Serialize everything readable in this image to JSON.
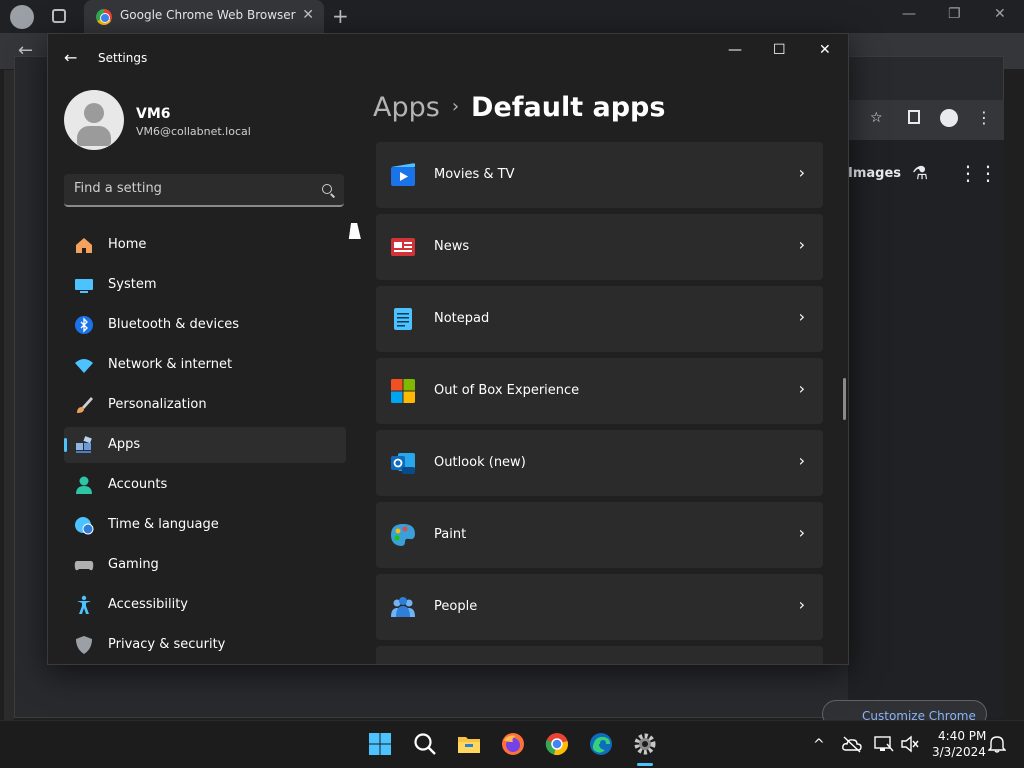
{
  "chrome": {
    "tab_title": "Google Chrome Web Browser",
    "tab_close": "✕",
    "new_tab": "+",
    "ntp_images_label": "Images",
    "customize_label": "Customize Chrome"
  },
  "settings": {
    "window_title": "Settings",
    "back_glyph": "←",
    "minimize_glyph": "—",
    "maximize_glyph": "☐",
    "close_glyph": "✕",
    "profile": {
      "name": "VM6",
      "email": "VM6@collabnet.local"
    },
    "search": {
      "placeholder": "Find a setting"
    },
    "nav": [
      {
        "label": "Home",
        "icon": "home-icon",
        "color": "#f2a25c"
      },
      {
        "label": "System",
        "icon": "system-icon",
        "color": "#4cc2ff"
      },
      {
        "label": "Bluetooth & devices",
        "icon": "bluetooth-icon",
        "color": "#1a73e8"
      },
      {
        "label": "Network & internet",
        "icon": "wifi-icon",
        "color": "#4cc2ff"
      },
      {
        "label": "Personalization",
        "icon": "brush-icon",
        "color": "#e8a15b"
      },
      {
        "label": "Apps",
        "icon": "apps-icon",
        "color": "#8fb4e6",
        "selected": true
      },
      {
        "label": "Accounts",
        "icon": "accounts-icon",
        "color": "#2ec4a6"
      },
      {
        "label": "Time & language",
        "icon": "globe-clock-icon",
        "color": "#4cc2ff"
      },
      {
        "label": "Gaming",
        "icon": "gamepad-icon",
        "color": "#b0b0b0"
      },
      {
        "label": "Accessibility",
        "icon": "accessibility-icon",
        "color": "#4cc2ff"
      },
      {
        "label": "Privacy & security",
        "icon": "shield-icon",
        "color": "#9aa0a6"
      }
    ],
    "breadcrumb": {
      "parent": "Apps",
      "separator": "›",
      "current": "Default apps"
    },
    "apps": [
      {
        "label": "Movies & TV",
        "icon": "movies-tv-icon",
        "color": "#1a73e8"
      },
      {
        "label": "News",
        "icon": "news-icon",
        "color": "#d13438"
      },
      {
        "label": "Notepad",
        "icon": "notepad-icon",
        "color": "#4cc2ff"
      },
      {
        "label": "Out of Box Experience",
        "icon": "windows-color-icon",
        "color": "#f25022"
      },
      {
        "label": "Outlook (new)",
        "icon": "outlook-icon",
        "color": "#0f6cbd"
      },
      {
        "label": "Paint",
        "icon": "paint-icon",
        "color": "#3aa0d8"
      },
      {
        "label": "People",
        "icon": "people-icon",
        "color": "#2f7fd8"
      }
    ],
    "chevron_glyph": "›"
  },
  "taskbar": {
    "time": "4:40 PM",
    "date": "3/3/2024",
    "tray_up": "^"
  }
}
